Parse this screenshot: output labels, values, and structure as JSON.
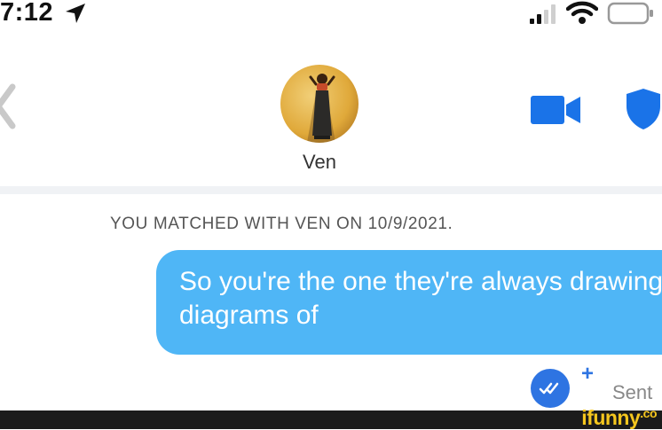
{
  "status_bar": {
    "time": "7:12"
  },
  "header": {
    "match_name": "Ven",
    "icons": {
      "back": "chevron-left-icon",
      "video": "video-camera-icon",
      "safety": "shield-icon"
    },
    "accent_color": "#1a73e8"
  },
  "conversation": {
    "match_date_text": "YOU MATCHED WITH VEN ON 10/9/2021.",
    "messages": [
      {
        "from": "me",
        "text": "So you're the one they're always drawing diagrams of",
        "bubble_color": "#4fb6f6",
        "status": "Sent"
      }
    ]
  },
  "watermark": {
    "text": "ifunny",
    "suffix": ".co"
  }
}
